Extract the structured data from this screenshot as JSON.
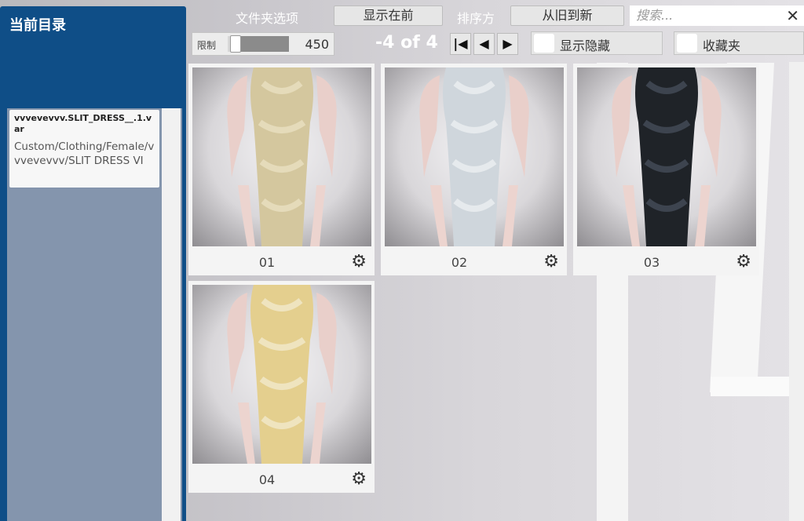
{
  "left_panel": {
    "title": "当前目录",
    "path_card": {
      "package": "vvvevevvv.SLIT_DRESS__.1.var",
      "path": "Custom/Clothing/Female/vvvevevvv/SLIT DRESS VI"
    }
  },
  "toolbar": {
    "folder_options_label": "文件夹选项",
    "show_first_button": "显示在前",
    "sort_label": "排序方",
    "sort_value": "从旧到新",
    "search_placeholder": "搜索...",
    "close_glyph": "✕",
    "limit_label": "限制",
    "limit_value": "450",
    "limit_level": 0.12,
    "page_info": "-4 of 4",
    "nav_first": "|◀",
    "nav_prev": "◀",
    "nav_next": "▶",
    "show_hidden_label": "显示隐藏",
    "favorites_label": "收藏夹"
  },
  "items": [
    {
      "label": "01",
      "dress_color": "#d4c79e",
      "pattern_color": "#ece4c6"
    },
    {
      "label": "02",
      "dress_color": "#cfd6dc",
      "pattern_color": "#f0f2f4"
    },
    {
      "label": "03",
      "dress_color": "#1f2328",
      "pattern_color": "#4a5260"
    },
    {
      "label": "04",
      "dress_color": "#e4cf8e",
      "pattern_color": "#f3ecd4"
    }
  ],
  "icons": {
    "settings": "gear-icon",
    "close": "close-icon"
  },
  "colors": {
    "panel_blue": "#0f4e87",
    "list_bg": "#8495ad"
  }
}
